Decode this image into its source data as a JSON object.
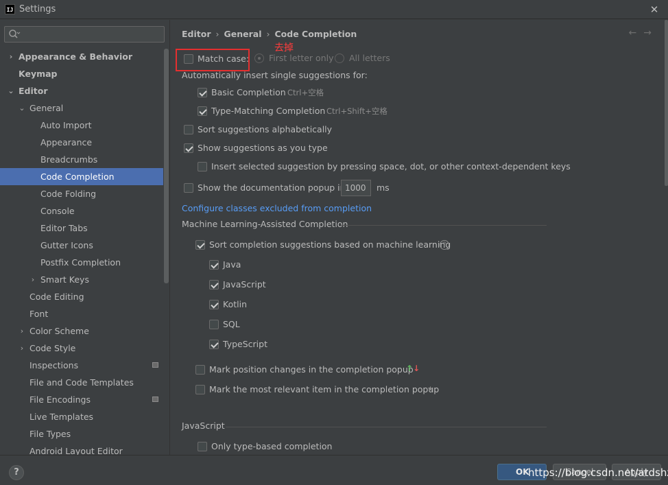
{
  "window": {
    "title": "Settings",
    "app_icon": "IJ"
  },
  "search": {
    "placeholder": "",
    "value": ""
  },
  "tree": [
    {
      "label": "Appearance & Behavior",
      "indent": 0,
      "chevron": "›",
      "bold": true
    },
    {
      "label": "Keymap",
      "indent": 0,
      "chevron": "",
      "bold": true
    },
    {
      "label": "Editor",
      "indent": 0,
      "chevron": "⌄",
      "bold": true
    },
    {
      "label": "General",
      "indent": 1,
      "chevron": "⌄"
    },
    {
      "label": "Auto Import",
      "indent": 2,
      "chevron": ""
    },
    {
      "label": "Appearance",
      "indent": 2,
      "chevron": ""
    },
    {
      "label": "Breadcrumbs",
      "indent": 2,
      "chevron": ""
    },
    {
      "label": "Code Completion",
      "indent": 2,
      "chevron": "",
      "selected": true
    },
    {
      "label": "Code Folding",
      "indent": 2,
      "chevron": ""
    },
    {
      "label": "Console",
      "indent": 2,
      "chevron": ""
    },
    {
      "label": "Editor Tabs",
      "indent": 2,
      "chevron": ""
    },
    {
      "label": "Gutter Icons",
      "indent": 2,
      "chevron": ""
    },
    {
      "label": "Postfix Completion",
      "indent": 2,
      "chevron": ""
    },
    {
      "label": "Smart Keys",
      "indent": 2,
      "chevron": "›"
    },
    {
      "label": "Code Editing",
      "indent": 1,
      "chevron": ""
    },
    {
      "label": "Font",
      "indent": 1,
      "chevron": ""
    },
    {
      "label": "Color Scheme",
      "indent": 1,
      "chevron": "›"
    },
    {
      "label": "Code Style",
      "indent": 1,
      "chevron": "›"
    },
    {
      "label": "Inspections",
      "indent": 1,
      "chevron": "",
      "badge": true
    },
    {
      "label": "File and Code Templates",
      "indent": 1,
      "chevron": ""
    },
    {
      "label": "File Encodings",
      "indent": 1,
      "chevron": "",
      "badge": true
    },
    {
      "label": "Live Templates",
      "indent": 1,
      "chevron": ""
    },
    {
      "label": "File Types",
      "indent": 1,
      "chevron": ""
    },
    {
      "label": "Android Layout Editor",
      "indent": 1,
      "chevron": ""
    }
  ],
  "breadcrumb": {
    "c1": "Editor",
    "c2": "General",
    "c3": "Code Completion",
    "sep": "›"
  },
  "nav": {
    "back": "←",
    "forward": "→"
  },
  "annotation": {
    "note": "去掉"
  },
  "options": {
    "match_case": "Match case:",
    "first_letter_only": "First letter only",
    "all_letters": "All letters",
    "auto_insert_title": "Automatically insert single suggestions for:",
    "basic_completion": "Basic Completion",
    "basic_shortcut": "Ctrl+空格",
    "type_matching": "Type-Matching Completion",
    "type_shortcut": "Ctrl+Shift+空格",
    "sort_alpha": "Sort suggestions alphabetically",
    "show_as_type": "Show suggestions as you type",
    "insert_selected": "Insert selected suggestion by pressing space, dot, or other context-dependent keys",
    "doc_popup": "Show the documentation popup in",
    "doc_popup_value": "1000",
    "doc_popup_unit": "ms",
    "configure_link": "Configure classes excluded from completion",
    "ml_section": "Machine Learning-Assisted Completion",
    "ml_sort": "Sort completion suggestions based on machine learning",
    "lang_java": "Java",
    "lang_js": "JavaScript",
    "lang_kotlin": "Kotlin",
    "lang_sql": "SQL",
    "lang_ts": "TypeScript",
    "mark_position": "Mark position changes in the completion popup",
    "mark_relevant": "Mark the most relevant item in the completion popup",
    "js_section": "JavaScript",
    "type_based": "Only type-based completion"
  },
  "icons": {
    "up": "↑",
    "down": "↓",
    "star": "★",
    "help": "?"
  },
  "footer": {
    "help": "?",
    "ok": "OK",
    "cancel": "Cancel",
    "apply": "Apply",
    "watermark": "https://blog.csdn.net/atdshz"
  }
}
